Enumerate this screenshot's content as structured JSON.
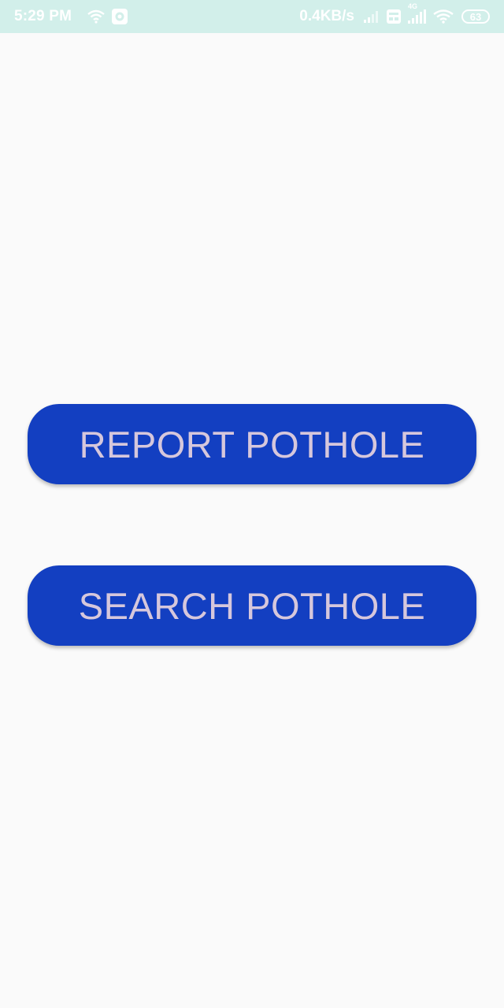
{
  "status_bar": {
    "time": "5:29 PM",
    "net_speed": "0.4KB/s",
    "network_type": "4G",
    "battery_level": "63",
    "icons": [
      "wifi-icon",
      "camera-app-icon",
      "signal-icon",
      "sim-icon",
      "signal-4g-icon",
      "wifi-icon",
      "battery-icon"
    ]
  },
  "main": {
    "report_label": "REPORT POTHOLE",
    "search_label": "SEARCH POTHOLE"
  },
  "colors": {
    "status_bar_bg": "#d2efea",
    "page_bg": "#fafafa",
    "button_bg": "#133fc1",
    "button_text": "#d6c7dc"
  }
}
